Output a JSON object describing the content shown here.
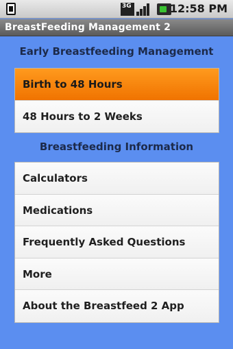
{
  "status_bar": {
    "time": "12:58 PM",
    "network": "3G",
    "icons": [
      "sim-icon",
      "3g-icon",
      "signal-icon",
      "battery-icon"
    ]
  },
  "app": {
    "title": "BreastFeeding Management 2"
  },
  "sections": {
    "early": {
      "header": "Early Breastfeeding Management",
      "items": [
        {
          "label": "Birth to 48 Hours",
          "selected": true
        },
        {
          "label": "48 Hours to 2 Weeks",
          "selected": false
        }
      ]
    },
    "info": {
      "header": "Breastfeeding Information",
      "items": [
        {
          "label": "Calculators"
        },
        {
          "label": "Medications"
        },
        {
          "label": "Frequently Asked Questions"
        },
        {
          "label": "More"
        },
        {
          "label": "About the Breastfeed 2 App"
        }
      ]
    }
  },
  "colors": {
    "background": "#5b8ef0",
    "selected": "#f58200",
    "title_bar": "#6e6e6e"
  }
}
